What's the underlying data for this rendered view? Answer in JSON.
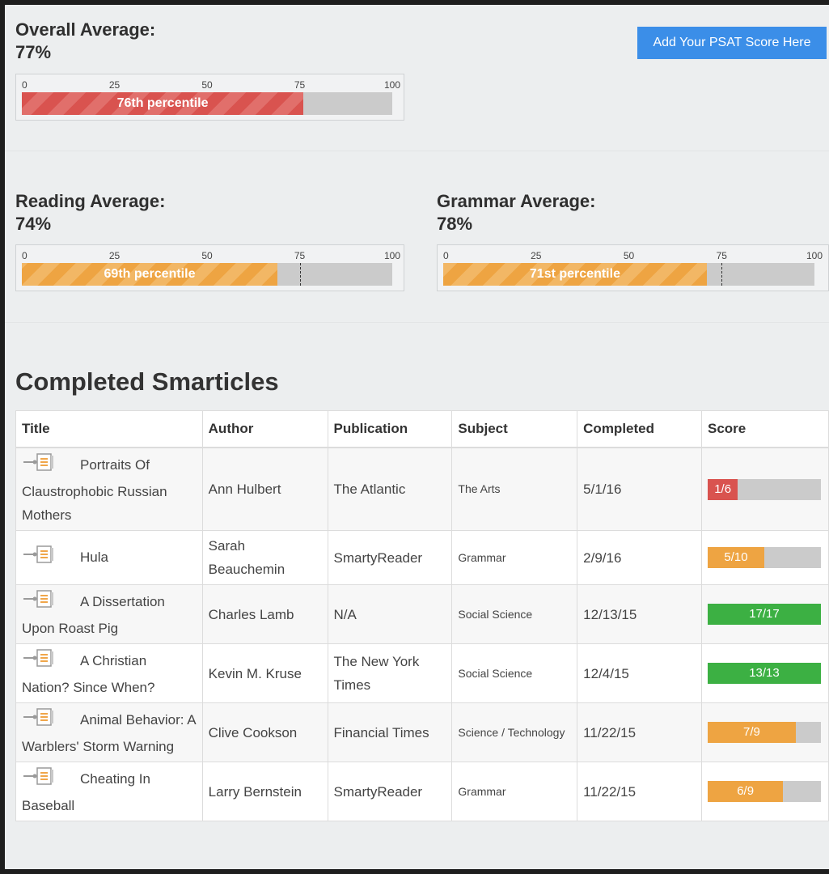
{
  "overall": {
    "title": "Overall Average:",
    "value": "77%",
    "percentile_label": "76th percentile",
    "percentile": 76,
    "color": "#d9534f"
  },
  "reading": {
    "title": "Reading Average:",
    "value": "74%",
    "percentile_label": "69th percentile",
    "percentile": 69,
    "marker": 75,
    "color": "#eea442"
  },
  "grammar": {
    "title": "Grammar Average:",
    "value": "78%",
    "percentile_label": "71st percentile",
    "percentile": 71,
    "marker": 75,
    "color": "#eea442"
  },
  "ticks": [
    "0",
    "25",
    "50",
    "75",
    "100"
  ],
  "psat_button": "Add Your PSAT Score Here",
  "section_title": "Completed Smarticles",
  "table": {
    "headers": [
      "Title",
      "Author",
      "Publication",
      "Subject",
      "Completed",
      "Score"
    ],
    "rows": [
      {
        "title": "Portraits Of Claustrophobic Russian Mothers",
        "author": "Ann Hulbert",
        "publication": "The Atlantic",
        "subject": "The Arts",
        "completed": "5/1/16",
        "score": "1/6",
        "score_ratio": 0.2667,
        "score_color": "#d9534f"
      },
      {
        "title": "Hula",
        "author": "Sarah Beauchemin",
        "publication": "SmartyReader",
        "subject": "Grammar",
        "completed": "2/9/16",
        "score": "5/10",
        "score_ratio": 0.5,
        "score_color": "#eea442"
      },
      {
        "title": "A Dissertation Upon Roast Pig",
        "author": "Charles Lamb",
        "publication": "N/A",
        "subject": "Social Science",
        "completed": "12/13/15",
        "score": "17/17",
        "score_ratio": 1.0,
        "score_color": "#3cb043"
      },
      {
        "title": "A Christian Nation? Since When?",
        "author": "Kevin M. Kruse",
        "publication": "The New York Times",
        "subject": "Social Science",
        "completed": "12/4/15",
        "score": "13/13",
        "score_ratio": 1.0,
        "score_color": "#3cb043"
      },
      {
        "title": "Animal Behavior: A Warblers' Storm Warning",
        "author": "Clive Cookson",
        "publication": "Financial Times",
        "subject": "Science / Technology",
        "completed": "11/22/15",
        "score": "7/9",
        "score_ratio": 0.7778,
        "score_color": "#eea442"
      },
      {
        "title": "Cheating In Baseball",
        "author": "Larry Bernstein",
        "publication": "SmartyReader",
        "subject": "Grammar",
        "completed": "11/22/15",
        "score": "6/9",
        "score_ratio": 0.6667,
        "score_color": "#eea442"
      }
    ]
  }
}
